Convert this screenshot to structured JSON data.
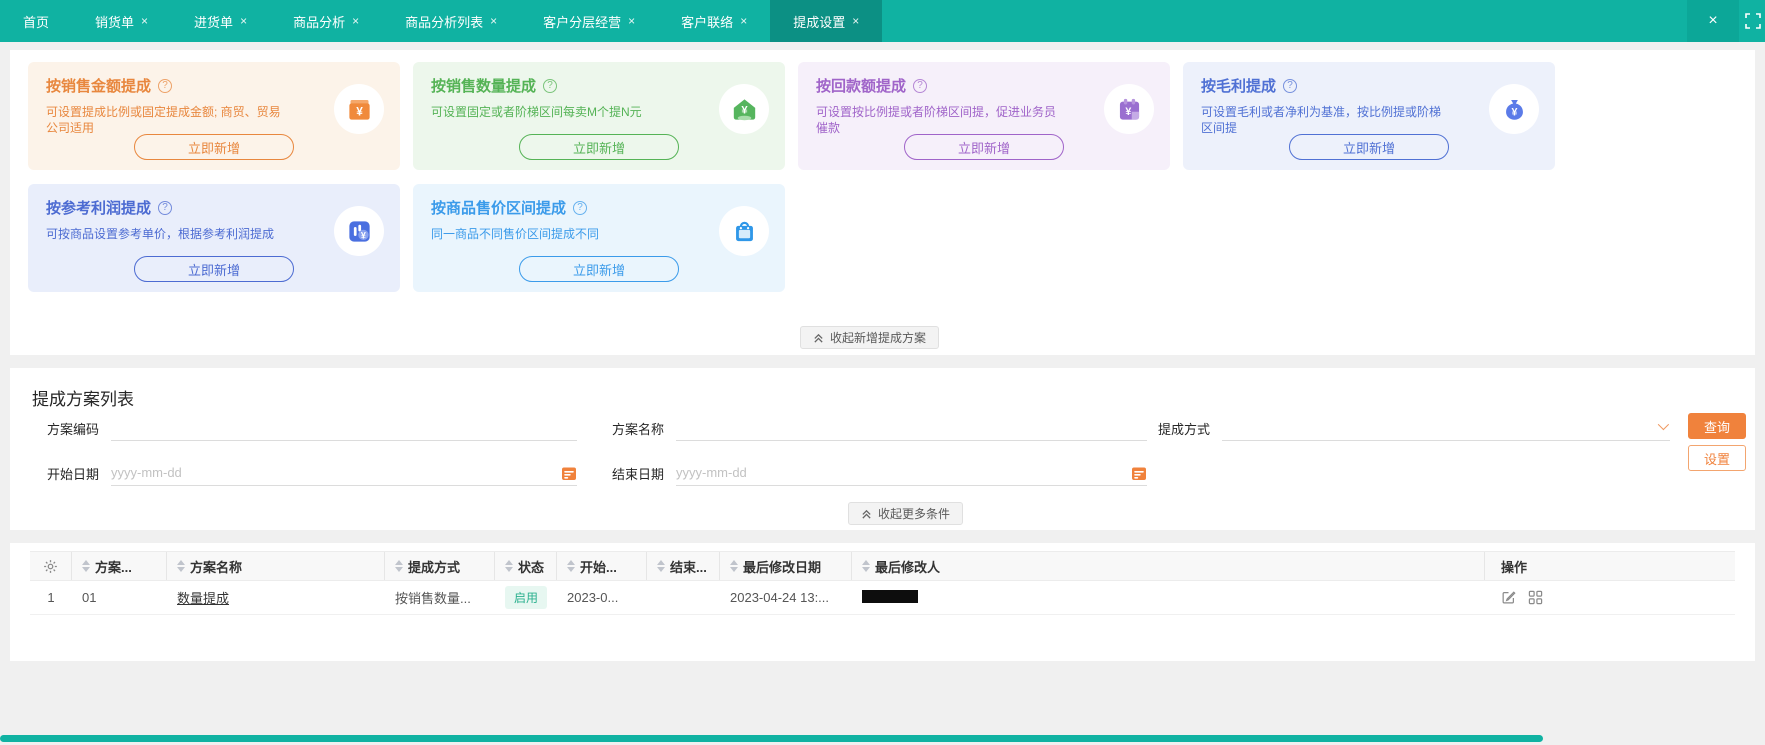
{
  "colors": {
    "tab_bar": "#10b2a2",
    "tab_active": "#0c9084",
    "accent_orange": "#f0823c",
    "status_text": "#2ab08e",
    "status_bg": "#e7f7f1",
    "page_bg": "#f0f0f0"
  },
  "glyphs": {
    "help": "?",
    "tab_close": "×",
    "close_all": "×"
  },
  "tab_bar": {
    "tabs": [
      {
        "label": "首页"
      },
      {
        "label": "销货单"
      },
      {
        "label": "进货单"
      },
      {
        "label": "商品分析"
      },
      {
        "label": "商品分析列表"
      },
      {
        "label": "客户分层经营"
      },
      {
        "label": "客户联络"
      },
      {
        "label": "提成设置"
      }
    ]
  },
  "cards": [
    {
      "title": "按销售金额提成",
      "desc": "可设置提成比例或固定提成金额; 商贸、贸易公司适用",
      "button": "立即新增",
      "accent": "#e8873e",
      "bg": "#fcf3e9",
      "icon": "cashbox"
    },
    {
      "title": "按销售数量提成",
      "desc": "可设置固定或者阶梯区间每卖M个提N元",
      "button": "立即新增",
      "accent": "#55b356",
      "bg": "#edf7ec",
      "icon": "home-yen"
    },
    {
      "title": "按回款额提成",
      "desc": "可设置按比例提或者阶梯区间提，促进业务员催款",
      "button": "立即新增",
      "accent": "#a064c9",
      "bg": "#f6f0fa",
      "icon": "calendar-yen"
    },
    {
      "title": "按毛利提成",
      "desc": "可设置毛利或者净利为基准，按比例提或阶梯区间提",
      "button": "立即新增",
      "accent": "#5071d4",
      "bg": "#edf1fb",
      "icon": "moneybag"
    },
    {
      "title": "按参考利润提成",
      "desc": "可按商品设置参考单价，根据参考利润提成",
      "button": "立即新增",
      "accent": "#4c6bd2",
      "bg": "#e9eefb",
      "icon": "chart-yen"
    },
    {
      "title": "按商品售价区间提成",
      "desc": "同一商品不同售价区间提成不同",
      "button": "立即新增",
      "accent": "#3b9bea",
      "bg": "#eaf5fd",
      "icon": "shopping-bag"
    }
  ],
  "cards_collapse_label": "收起新增提成方案",
  "list_panel": {
    "title": "提成方案列表",
    "filters": {
      "code_label": "方案编码",
      "name_label": "方案名称",
      "type_label": "提成方式",
      "start_label": "开始日期",
      "end_label": "结束日期",
      "date_placeholder": "yyyy-mm-dd",
      "search_button": "查询",
      "settings_button": "设置",
      "collapse_label": "收起更多条件"
    }
  },
  "table": {
    "headers": [
      "方案...",
      "方案名称",
      "提成方式",
      "状态",
      "开始...",
      "结束...",
      "最后修改日期",
      "最后修改人"
    ],
    "action_header": "操作",
    "rows": [
      {
        "index": "1",
        "code": "01",
        "name": "数量提成",
        "type": "按销售数量...",
        "status": "启用",
        "start": "2023-0...",
        "end": "",
        "modified_date": "2023-04-24 13:...",
        "modified_by_redacted": true
      }
    ]
  }
}
